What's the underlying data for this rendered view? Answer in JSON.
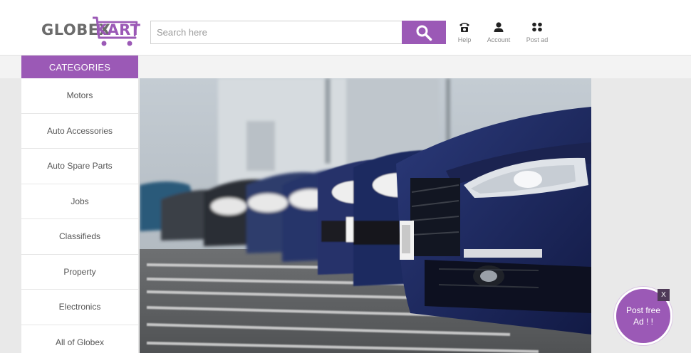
{
  "header": {
    "logo": {
      "part1": "Globex",
      "part2": "KART"
    },
    "search": {
      "placeholder": "Search here",
      "value": ""
    },
    "nav": [
      {
        "label": "Help",
        "icon": "telephone-icon"
      },
      {
        "label": "Account",
        "icon": "user-icon"
      },
      {
        "label": "Post ad",
        "icon": "grid-icon"
      }
    ]
  },
  "sidebar": {
    "title": "CATEGORIES",
    "items": [
      {
        "label": "Motors"
      },
      {
        "label": "Auto Accessories"
      },
      {
        "label": "Auto Spare Parts"
      },
      {
        "label": "Jobs"
      },
      {
        "label": "Classifieds"
      },
      {
        "label": "Property"
      },
      {
        "label": "Electronics"
      },
      {
        "label": "All of Globex"
      }
    ]
  },
  "promo": {
    "line1": "Post free",
    "line2": "Ad ! !",
    "close": "X"
  },
  "colors": {
    "accent": "#9b59b6",
    "text": "#555555",
    "background": "#e9e9e9"
  }
}
